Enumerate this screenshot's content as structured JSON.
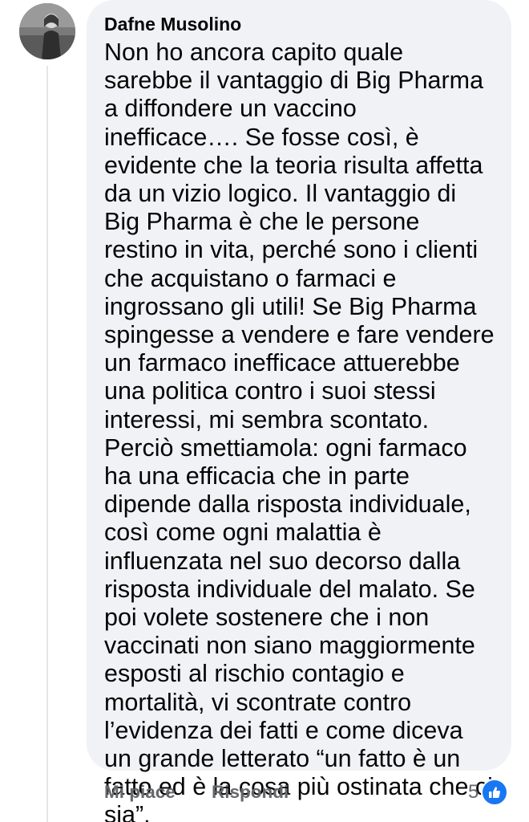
{
  "comment": {
    "author": "Dafne Musolino",
    "text": "Non ho ancora capito quale sarebbe il vantaggio di Big Pharma a diffondere un vaccino inefficace…. Se fosse così, è evidente che la teoria risulta affetta da un vizio logico. Il vantaggio di Big Pharma è che le persone restino in vita, perché sono i clienti che acquistano o farmaci e ingrossano gli utili! Se Big Pharma spingesse a vendere e fare vendere un farmaco inefficace attuerebbe una politica contro i suoi stessi interessi, mi sembra scontato. Perciò smettiamola: ogni farmaco ha una efficacia che in parte dipende dalla risposta individuale, così come ogni malattia è influenzata nel suo decorso dalla risposta individuale del malato. Se poi volete sostenere che i non vaccinati non siano maggiormente esposti al rischio contagio e mortalità, vi scontrate contro l’evidenza dei fatti e come diceva un grande letterato “un fatto è un fatto ed è la cosa più ostinata che ci sia”."
  },
  "actions": {
    "like_label": "Mi piace",
    "reply_label": "Rispondi"
  },
  "reactions": {
    "count": "5",
    "icon": "thumbs-up-icon",
    "color": "#1877f2"
  },
  "colors": {
    "bubble": "#f0f2f5",
    "text": "#050505",
    "secondary": "#65676b"
  }
}
